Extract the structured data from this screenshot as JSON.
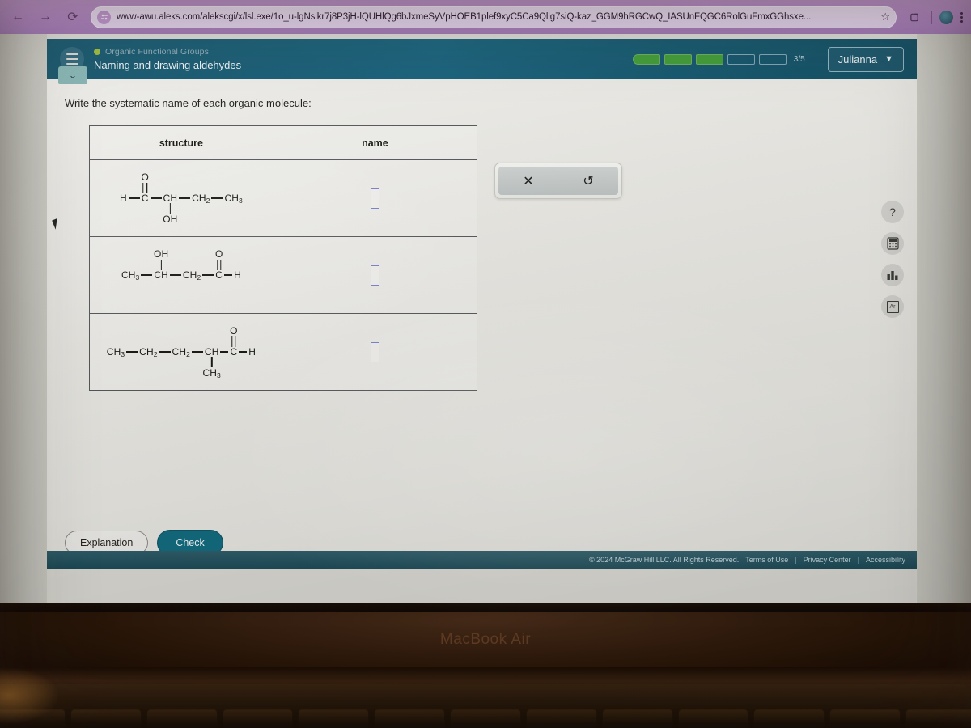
{
  "browser": {
    "back_icon": "arrow-left-icon",
    "forward_icon": "arrow-right-icon",
    "reload_icon": "reload-icon",
    "site_info_icon": "site-settings-icon",
    "url": "www-awu.aleks.com/alekscgi/x/lsl.exe/1o_u-lgNslkr7j8P3jH-lQUHlQg6bJxmeSyVpHOEB1plef9xyC5Ca9Qllg7siQ-kaz_GGM9hRGCwQ_IASUnFQGC6RolGuFmxGGhsxe...",
    "bookmark_icon": "star-icon",
    "extensions_icon": "tab-copy-icon",
    "menu_icon": "kebab-menu-icon"
  },
  "header": {
    "menu_icon": "hamburger-icon",
    "topic": "Organic Functional Groups",
    "lesson_title": "Naming and drawing aldehydes",
    "progress_total": 5,
    "progress_filled": 3,
    "progress_label": "3/5",
    "user_name": "Julianna",
    "user_chevron": "▼"
  },
  "content": {
    "collapse_icon": "chevron-down-icon",
    "prompt": "Write the systematic name of each organic molecule:",
    "table": {
      "headers": [
        "structure",
        "name"
      ],
      "rows": [
        {
          "structure_text": "H—C(=O)—CH(OH)—CH2—CH3",
          "main": [
            {
              "label": "H"
            },
            {
              "label": "C",
              "up": "O",
              "up_bond": "double"
            },
            {
              "label": "CH",
              "down": "OH",
              "down_bond": "single"
            },
            {
              "label": "CH",
              "sub": "2"
            },
            {
              "label": "CH",
              "sub": "3"
            }
          ],
          "answer_value": "",
          "answer_placeholder": ""
        },
        {
          "structure_text": "CH3—CH(OH)—CH2—C(=O)—H",
          "main": [
            {
              "label": "CH",
              "sub": "3"
            },
            {
              "label": "CH",
              "up": "OH",
              "up_bond": "single"
            },
            {
              "label": "CH",
              "sub": "2"
            },
            {
              "label": "C",
              "up": "O",
              "up_bond": "double"
            },
            {
              "label": "H"
            }
          ],
          "answer_value": "",
          "answer_placeholder": ""
        },
        {
          "structure_text": "CH3—CH2—CH2—CH(CH3)—C(=O)—H",
          "main": [
            {
              "label": "CH",
              "sub": "3"
            },
            {
              "label": "CH",
              "sub": "2"
            },
            {
              "label": "CH",
              "sub": "2"
            },
            {
              "label": "CH",
              "down": "CH3",
              "down_bond": "single"
            },
            {
              "label": "C",
              "up": "O",
              "up_bond": "double"
            },
            {
              "label": "H"
            }
          ],
          "answer_value": "",
          "answer_placeholder": ""
        }
      ]
    },
    "answer_toolbar": {
      "clear_icon": "close-x-icon",
      "clear_label": "✕",
      "undo_icon": "undo-icon",
      "undo_label": "↺"
    },
    "tool_rail": [
      {
        "name": "help-icon",
        "glyph": "?"
      },
      {
        "name": "calculator-icon",
        "glyph": "▦"
      },
      {
        "name": "chart-icon",
        "glyph": "▁▃▂"
      },
      {
        "name": "periodic-table-icon",
        "glyph": "Ar"
      }
    ],
    "explanation_label": "Explanation",
    "check_label": "Check"
  },
  "footer": {
    "copyright": "© 2024 McGraw Hill LLC. All Rights Reserved.",
    "terms": "Terms of Use",
    "privacy": "Privacy Center",
    "accessibility": "Accessibility",
    "separator": "|"
  },
  "device": {
    "label": "MacBook Air"
  },
  "colors": {
    "aleks_teal": "#14546b",
    "progress_green": "#3f9c35",
    "check_button": "#136b7f",
    "answer_box_border": "#7a7fcc",
    "browser_chrome": "#a97fbb"
  }
}
